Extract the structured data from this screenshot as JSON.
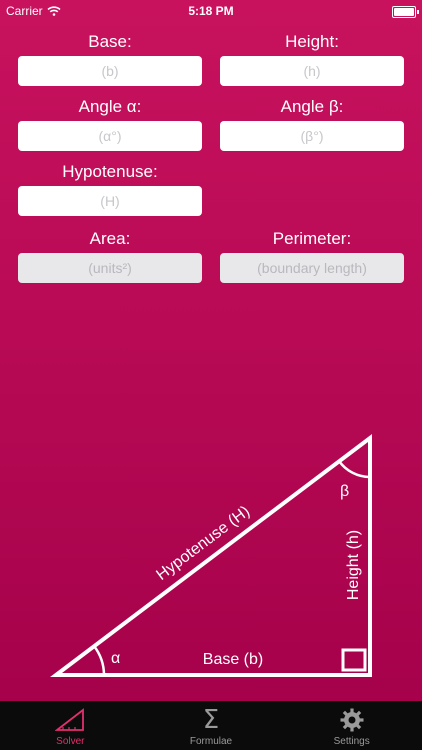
{
  "status_bar": {
    "carrier": "Carrier",
    "time": "5:18 PM"
  },
  "form": {
    "base": {
      "label": "Base:",
      "placeholder": "(b)"
    },
    "height": {
      "label": "Height:",
      "placeholder": "(h)"
    },
    "angle_a": {
      "label": "Angle α:",
      "placeholder": "(α°)"
    },
    "angle_b": {
      "label": "Angle β:",
      "placeholder": "(β°)"
    },
    "hypotenuse": {
      "label": "Hypotenuse:",
      "placeholder": "(H)"
    },
    "area": {
      "label": "Area:",
      "placeholder": "(units²)"
    },
    "perimeter": {
      "label": "Perimeter:",
      "placeholder": "(boundary length)"
    }
  },
  "diagram": {
    "hypotenuse_label": "Hypotenuse (H)",
    "height_label": "Height (h)",
    "base_label": "Base (b)",
    "alpha": "α",
    "beta": "β"
  },
  "tabs": [
    {
      "label": "Solver",
      "icon": "triangle-ruler-icon",
      "active": true
    },
    {
      "label": "Formulae",
      "icon": "sigma-icon",
      "active": false
    },
    {
      "label": "Settings",
      "icon": "gear-icon",
      "active": false
    }
  ],
  "colors": {
    "background": "#b80a55",
    "accent": "#e0306f",
    "tabbar": "#0b0b0b"
  }
}
